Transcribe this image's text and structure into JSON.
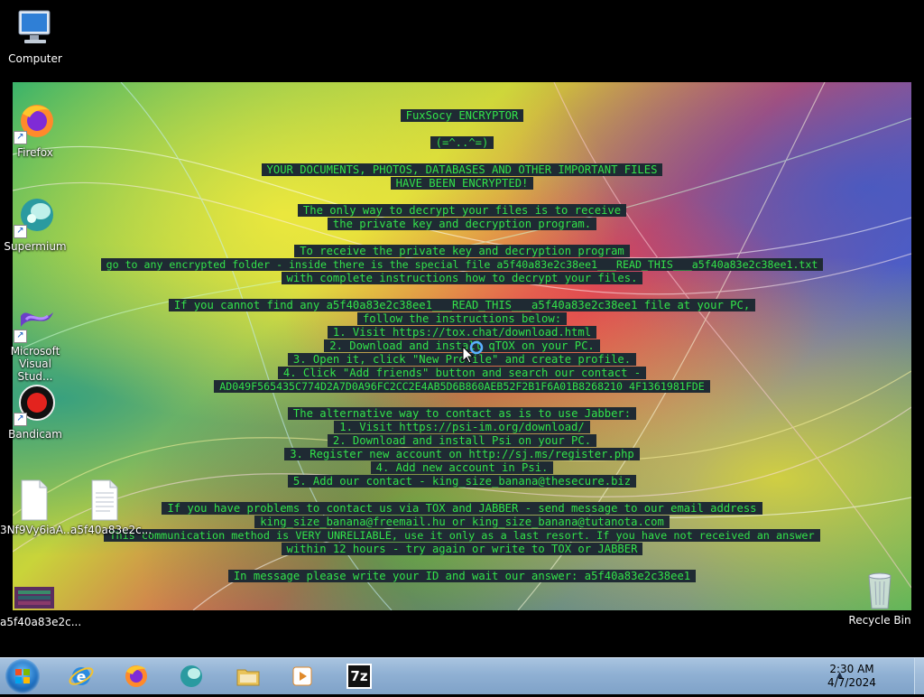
{
  "desktop": {
    "icons": [
      {
        "label": "Computer"
      },
      {
        "label": "Firefox"
      },
      {
        "label": "Supermium"
      },
      {
        "label": "Microsoft Visual Stud..."
      },
      {
        "label": "Bandicam"
      },
      {
        "label": "3Nf9Vy6iaA..."
      },
      {
        "label": "a5f40a83e2c..."
      },
      {
        "label": "a5f40a83e2c..."
      },
      {
        "label": "Recycle Bin"
      }
    ]
  },
  "ransom_note": {
    "lines": [
      "FuxSocy ENCRYPTOR",
      "(=^..^=)",
      "YOUR DOCUMENTS, PHOTOS, DATABASES AND OTHER IMPORTANT FILES",
      "HAVE BEEN ENCRYPTED!",
      "The only way to decrypt your files is to receive",
      "the private key and decryption program.",
      "To receive the private key and decryption program",
      "go to any encrypted folder - inside there is the special file a5f40a83e2c38ee1___READ_THIS___a5f40a83e2c38ee1.txt",
      "with complete instructions how to decrypt your files.",
      "If you cannot find any a5f40a83e2c38ee1___READ_THIS___a5f40a83e2c38ee1 file at your PC,",
      "follow the instructions below:",
      "1. Visit https://tox.chat/download.html",
      "2. Download and install qTOX on your PC.",
      "3. Open it, click \"New Profile\" and create profile.",
      "4. Click \"Add friends\" button and search our contact -",
      "AD049F565435C774D2A7D0A96FC2CC2E4AB5D6B860AEB52F2B1F6A01B8268210 4F1361981FDE",
      "The alternative way to contact as is to use Jabber:",
      "1. Visit https://psi-im.org/download/",
      "2. Download and install Psi on your PC.",
      "3. Register new account on http://sj.ms/register.php",
      "4. Add new account in Psi.",
      "5. Add our contact - king_size_banana@thesecure.biz",
      "If you have problems to contact us via TOX and JABBER - send message to our email address",
      "king_size_banana@freemail.hu or king_size_banana@tutanota.com",
      "This communication method is VERY UNRELIABLE, use it only as a last resort. If you have not received an answer",
      "within 12 hours - try again or write to TOX or JABBER",
      "In message please write your ID and wait our answer: a5f40a83e2c38ee1"
    ]
  },
  "taskbar": {
    "items": [
      "Internet Explorer",
      "Firefox",
      "Supermium",
      "File Explorer",
      "Media Player",
      "7-Zip"
    ],
    "seven_zip_label": "7z",
    "clock_time": "2:30 AM",
    "clock_date": "4/7/2024"
  },
  "colors": {
    "note_text": "#33e24a",
    "note_bg": "#1f2a33",
    "taskbar": "#8fb0d3"
  }
}
